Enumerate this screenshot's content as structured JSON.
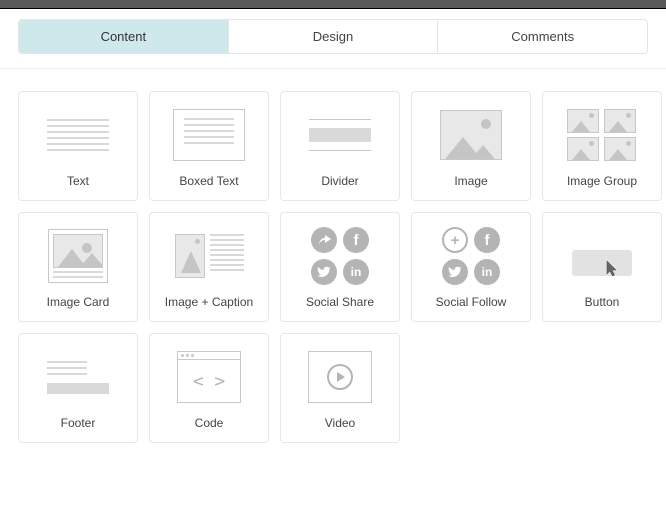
{
  "tabs": [
    {
      "label": "Content",
      "active": true
    },
    {
      "label": "Design",
      "active": false
    },
    {
      "label": "Comments",
      "active": false
    }
  ],
  "blocks": {
    "text": "Text",
    "boxed_text": "Boxed Text",
    "divider": "Divider",
    "image": "Image",
    "image_group": "Image Group",
    "image_card": "Image Card",
    "image_caption": "Image + Caption",
    "social_share": "Social Share",
    "social_follow": "Social Follow",
    "button": "Button",
    "footer": "Footer",
    "code": "Code",
    "video": "Video"
  }
}
